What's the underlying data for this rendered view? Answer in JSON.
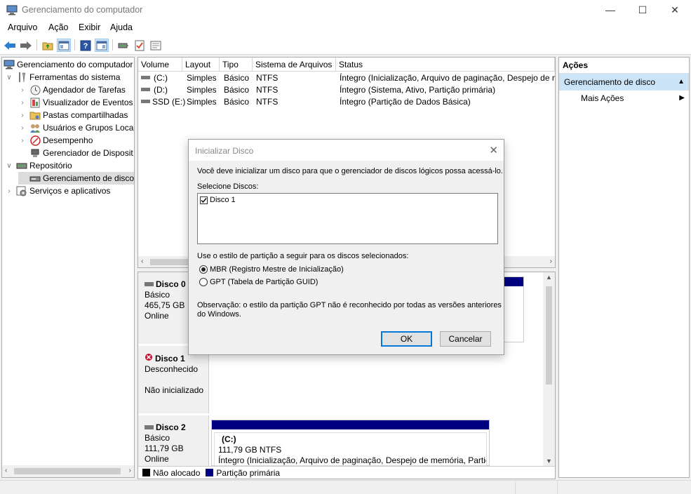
{
  "window": {
    "title": "Gerenciamento do computador",
    "minimize": "—",
    "maximize": "☐",
    "close": "✕"
  },
  "menu": [
    "Arquivo",
    "Ação",
    "Exibir",
    "Ajuda"
  ],
  "tree": {
    "items": [
      {
        "label": "Gerenciamento do computador",
        "arrow": ""
      },
      {
        "label": "Ferramentas do sistema",
        "arrow": "∨"
      },
      {
        "label": "Agendador de Tarefas",
        "arrow": "›"
      },
      {
        "label": "Visualizador de Eventos",
        "arrow": "›"
      },
      {
        "label": "Pastas compartilhadas",
        "arrow": "›"
      },
      {
        "label": "Usuários e Grupos Loca",
        "arrow": "›"
      },
      {
        "label": "Desempenho",
        "arrow": "›"
      },
      {
        "label": "Gerenciador de Disposit",
        "arrow": ""
      },
      {
        "label": "Repositório",
        "arrow": "∨"
      },
      {
        "label": "Gerenciamento de disco",
        "arrow": ""
      },
      {
        "label": "Serviços e aplicativos",
        "arrow": "›"
      }
    ]
  },
  "volumes": {
    "columns": [
      "Volume",
      "Layout",
      "Tipo",
      "Sistema de Arquivos",
      "Status"
    ],
    "rows": [
      [
        "(C:)",
        "Simples",
        "Básico",
        "NTFS",
        "Íntegro (Inicialização, Arquivo de paginação, Despejo de m"
      ],
      [
        "(D:)",
        "Simples",
        "Básico",
        "NTFS",
        "Íntegro (Sistema, Ativo, Partição primária)"
      ],
      [
        "SSD (E:)",
        "Simples",
        "Básico",
        "NTFS",
        "Íntegro (Partição de Dados Básica)"
      ]
    ]
  },
  "disks": [
    {
      "name": "Disco 0",
      "type": "Básico",
      "size": "465,75 GB",
      "state": "Online"
    },
    {
      "name": "Disco 1",
      "type": "Desconhecido",
      "state": "Não inicializado"
    },
    {
      "name": "Disco 2",
      "type": "Básico",
      "size": "111,79 GB",
      "state": "Online",
      "partition": {
        "name": "(C:)",
        "size": "111,79 GB NTFS",
        "status": "Íntegro (Inicialização, Arquivo de paginação, Despejo de memória, Partiç"
      }
    }
  ],
  "legend": [
    {
      "label": "Não alocado",
      "color": "#000000"
    },
    {
      "label": "Partição primária",
      "color": "#000080"
    }
  ],
  "actions": {
    "header": "Ações",
    "section": "Gerenciamento de disco",
    "more": "Mais Ações"
  },
  "dialog": {
    "title": "Inicializar Disco",
    "intro": "Você deve inicializar um disco para que o gerenciador de discos lógicos possa acessá-lo.",
    "select_label": "Selecione Discos:",
    "disk_item": "Disco 1",
    "style_label": "Use o estilo de partição a seguir para os discos selecionados:",
    "mbr": "MBR (Registro Mestre de Inicialização)",
    "gpt": "GPT (Tabela de Partição GUID)",
    "note_line1": "Observação: o estilo da partição GPT não é reconhecido por todas as versões anteriores",
    "note_line2": "do Windows.",
    "ok": "OK",
    "cancel": "Cancelar"
  },
  "colors": {
    "accent": "#0078d7",
    "selection": "#cce4f7",
    "partition_bar": "#000080"
  }
}
